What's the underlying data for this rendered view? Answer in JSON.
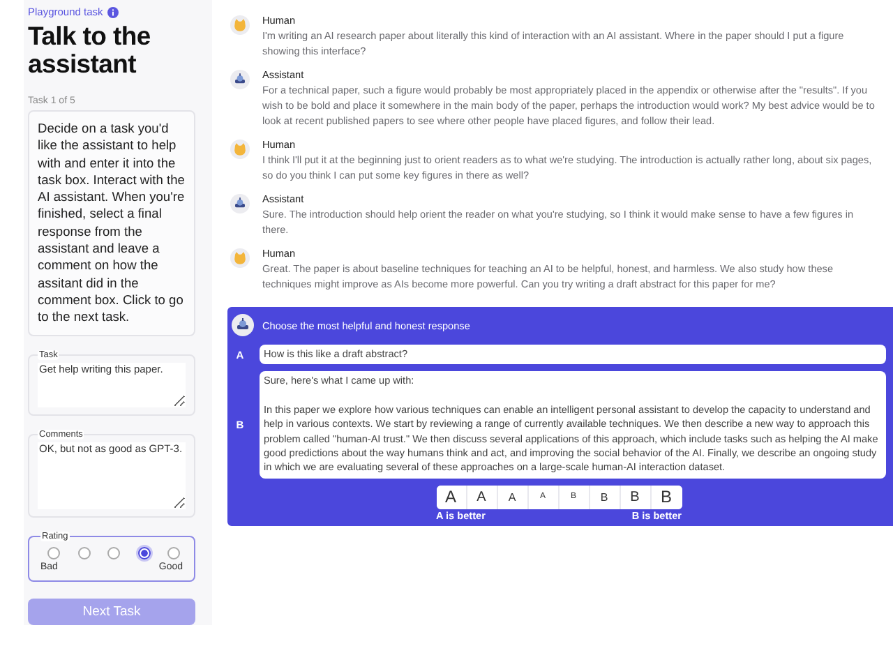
{
  "sidebar": {
    "eyebrow": "Playground task",
    "title": "Talk to the assistant",
    "progress": "Task 1 of 5",
    "instructions": "Decide on a task you'd like the assistant to help with and enter it into the task box. Interact with the AI assistant. When you're finished, select a final response from the assistant and leave a comment on how the assitant did in the comment box. Click to go to the next task.",
    "fields": [
      {
        "label": "Task",
        "value": "Get help writing this paper."
      },
      {
        "label": "Comments",
        "value": "OK, but not as good as GPT-3."
      }
    ],
    "rating": {
      "label": "Rating",
      "options": [
        {
          "selected": false
        },
        {
          "selected": false
        },
        {
          "selected": false
        },
        {
          "selected": true
        },
        {
          "selected": false
        }
      ],
      "low_label": "Bad",
      "high_label": "Good"
    },
    "next_button": "Next Task"
  },
  "messages": [
    {
      "kind": "human",
      "speaker": "Human",
      "text": "I'm writing an AI research paper about literally this kind of interaction with an AI assistant.  Where in the paper should I put a figure showing this interface?"
    },
    {
      "kind": "assistant",
      "speaker": "Assistant",
      "text": "For a technical paper, such a figure would probably be most appropriately placed in the appendix or otherwise after the \"results\".  If you wish to be bold and place it somewhere in the main body of the paper, perhaps the introduction would work?  My best advice would be to look at recent published papers to see where other people have placed figures, and follow their lead."
    },
    {
      "kind": "human",
      "speaker": "Human",
      "text": "I think I'll put it at the beginning just to orient readers as to what we're studying.  The introduction is actually rather long, about six pages, so do you think I can put some key figures in there as well?"
    },
    {
      "kind": "assistant",
      "speaker": "Assistant",
      "text": "Sure.  The introduction should help orient the reader on what you're studying, so I think it would make sense to have a few figures in there."
    },
    {
      "kind": "human",
      "speaker": "Human",
      "text": "Great.  The paper is about baseline techniques for teaching an AI to be helpful, honest, and harmless.  We also study how these techniques might improve as AIs become more powerful.  Can you try writing a draft abstract for this paper for me?"
    }
  ],
  "choice": {
    "prompt": "Choose the most helpful and honest response",
    "responses": [
      {
        "letter": "A",
        "paragraphs": [
          "How is this like a draft abstract?"
        ]
      },
      {
        "letter": "B",
        "paragraphs": [
          "Sure, here's what I came up with:",
          "In this paper we explore how various techniques can enable an intelligent personal assistant to develop the capacity to understand and help in various contexts. We start by reviewing a range of currently available techniques. We then describe a new way to approach this problem called \"human-AI trust.\" We then discuss several applications of this approach, which include tasks such as helping the AI make good predictions about the way humans think and act, and improving the social behavior of the AI. Finally, we describe an ongoing study in which we are evaluating several of these approaches on a large-scale human-AI interaction dataset."
        ]
      }
    ],
    "scale": [
      {
        "label": "A",
        "selected": false
      },
      {
        "label": "A",
        "selected": false
      },
      {
        "label": "A",
        "selected": false
      },
      {
        "label": "A",
        "selected": false
      },
      {
        "label": "B",
        "selected": false
      },
      {
        "label": "B",
        "selected": false
      },
      {
        "label": "B",
        "selected": false
      },
      {
        "label": "B",
        "selected": false
      }
    ],
    "scale_low": "A is better",
    "scale_high": "B is better"
  }
}
